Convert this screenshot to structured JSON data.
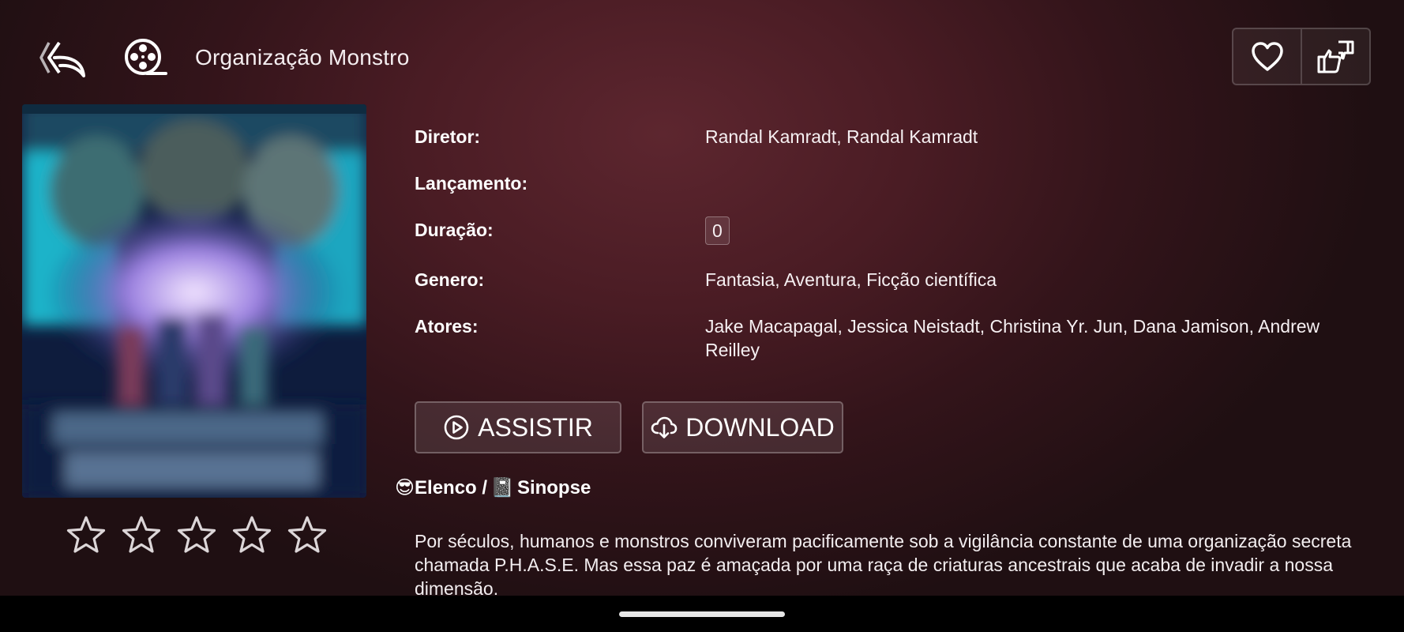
{
  "header": {
    "title": "Organização Monstro",
    "back_icon": "back-arrow-icon",
    "film_icon": "film-reel-icon",
    "favorite_icon": "heart-icon",
    "rate_icon": "thumbs-up-down-icon"
  },
  "poster": {
    "title_lines": [
      "ORGANIZAÇÃO",
      "MONSTRO"
    ]
  },
  "rating": {
    "stars_total": 5,
    "stars_filled": 0
  },
  "details": {
    "director_label": "Diretor:",
    "director_value": "Randal Kamradt, Randal Kamradt",
    "release_label": "Lançamento:",
    "release_value": "",
    "duration_label": "Duração:",
    "duration_value": "0",
    "genre_label": "Genero:",
    "genre_value": "Fantasia, Aventura, Ficção científica",
    "actors_label": "Atores:",
    "actors_value": "Jake Macapagal, Jessica Neistadt, Christina Yr. Jun, Dana Jamison, Andrew Reilley"
  },
  "buttons": {
    "watch_label": "ASSISTIR",
    "download_label": "DOWNLOAD"
  },
  "section": {
    "cast_label": "😎Elenco / ",
    "synopsis_icon": "📓",
    "synopsis_label": " Sinopse"
  },
  "synopsis": "Por séculos, humanos e monstros conviveram pacificamente sob a vigilância constante de uma organização secreta chamada P.H.A.S.E. Mas essa paz é amaçada por uma raça de criaturas ancestrais que acaba de invadir a nossa dimensão.",
  "colors": {
    "background": "#4a1c24",
    "accent": "#ffffff"
  }
}
